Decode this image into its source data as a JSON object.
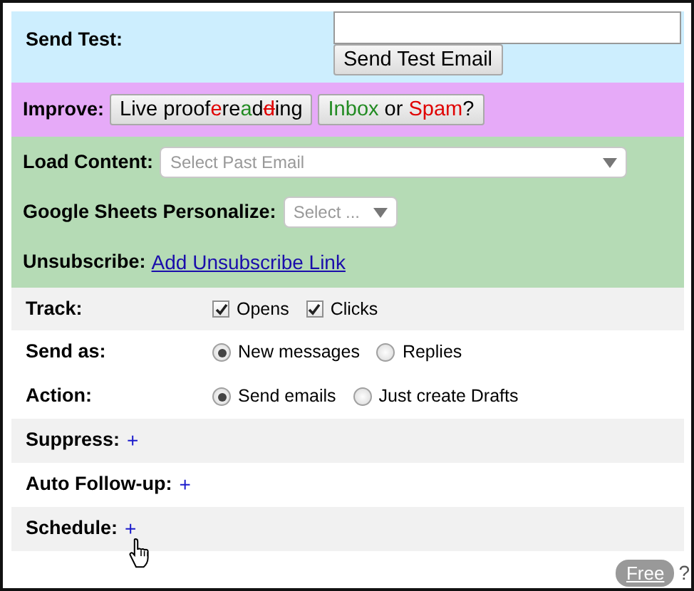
{
  "sections": [
    {
      "color": "#cdeefe",
      "rows": [
        {
          "kind": "send_test",
          "label": "Send Test:",
          "button": "Send Test Email"
        }
      ]
    },
    {
      "color": "#e6aaf8",
      "rows": [
        {
          "kind": "buttons",
          "label": "Improve:",
          "buttons": [
            {
              "segments": [
                {
                  "text": "Live proof",
                  "kind": "plain"
                },
                {
                  "text": "e",
                  "kind": "wrong"
                },
                {
                  "text": "re",
                  "kind": "plain"
                },
                {
                  "text": "a",
                  "kind": "fix"
                },
                {
                  "text": "d",
                  "kind": "plain"
                },
                {
                  "text": "d",
                  "kind": "struck"
                },
                {
                  "text": "ing",
                  "kind": "plain"
                }
              ]
            },
            {
              "segments": [
                {
                  "text": "Inbox",
                  "kind": "fix"
                },
                {
                  "text": " or ",
                  "kind": "plain"
                },
                {
                  "text": "Spam",
                  "kind": "wrong"
                },
                {
                  "text": "?",
                  "kind": "plain"
                }
              ]
            }
          ]
        }
      ]
    },
    {
      "color": "#b5dbb5",
      "rows": [
        {
          "kind": "select_wide",
          "label": "Load Content:",
          "placeholder": "Select Past Email"
        },
        {
          "kind": "select",
          "label": "Google Sheets Personalize:",
          "placeholder": "Select ..."
        },
        {
          "kind": "link",
          "label": "Unsubscribe:",
          "link": "Add Unsubscribe Link"
        }
      ]
    },
    {
      "color": "#f1f1f1",
      "rows": [
        {
          "kind": "checks",
          "label": "Track:",
          "options": [
            {
              "label": "Opens",
              "checked": true
            },
            {
              "label": "Clicks",
              "checked": true
            }
          ]
        }
      ]
    },
    {
      "color": "#ffffff",
      "rows": [
        {
          "kind": "radios",
          "label": "Send as:",
          "options": [
            {
              "label": "New messages",
              "selected": true
            },
            {
              "label": "Replies",
              "selected": false
            }
          ]
        },
        {
          "kind": "radios",
          "label": "Action:",
          "options": [
            {
              "label": "Send emails",
              "selected": true
            },
            {
              "label": "Just create Drafts",
              "selected": false
            }
          ]
        }
      ]
    },
    {
      "color": "#f1f1f1",
      "rows": [
        {
          "kind": "plus",
          "label": "Suppress:",
          "plus": "+",
          "cursor": false
        }
      ]
    },
    {
      "color": "#ffffff",
      "rows": [
        {
          "kind": "plus",
          "label": "Auto Follow-up:",
          "plus": "+",
          "cursor": false
        }
      ]
    },
    {
      "color": "#f1f1f1",
      "rows": [
        {
          "kind": "plus",
          "label": "Schedule:",
          "plus": "+",
          "cursor": true
        }
      ]
    }
  ],
  "footer": {
    "badge": "Free",
    "help": "?"
  }
}
